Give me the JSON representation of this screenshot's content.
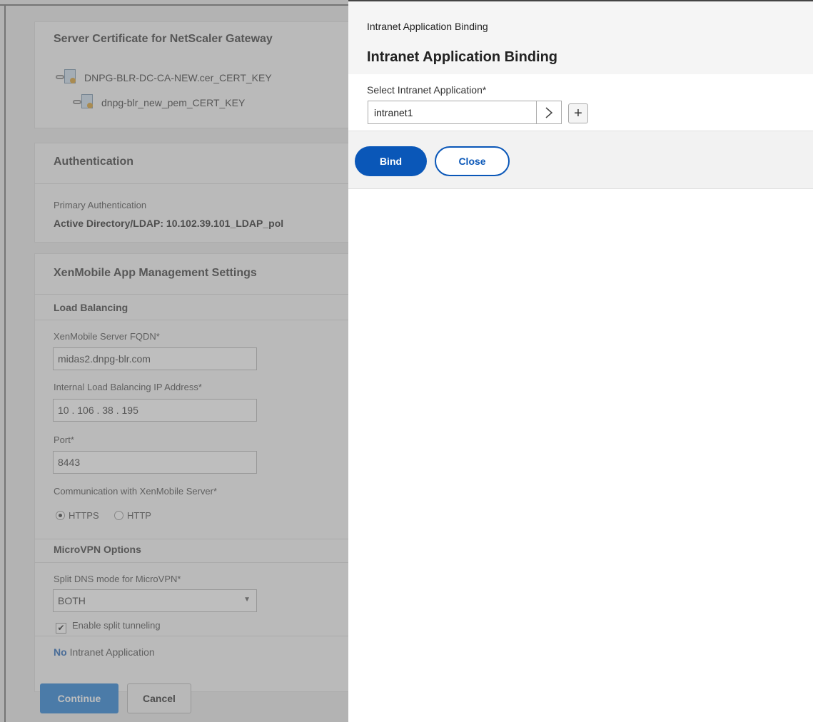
{
  "background": {
    "certificate": {
      "heading": "Server Certificate for NetScaler Gateway",
      "items": [
        "DNPG-BLR-DC-CA-NEW.cer_CERT_KEY",
        "dnpg-blr_new_pem_CERT_KEY"
      ]
    },
    "authentication": {
      "heading": "Authentication",
      "primary_label": "Primary Authentication",
      "primary_value": "Active Directory/LDAP: 10.102.39.101_LDAP_pol"
    },
    "xenmobile": {
      "heading": "XenMobile App Management Settings",
      "load_balancing": "Load Balancing",
      "fqdn_label": "XenMobile Server FQDN*",
      "fqdn_value": "midas2.dnpg-blr.com",
      "ip_label": "Internal Load Balancing IP Address*",
      "ip_value": "10 . 106 . 38 . 195",
      "port_label": "Port*",
      "port_value": "8443",
      "comm_label": "Communication with XenMobile Server*",
      "opt_https": "HTTPS",
      "opt_http": "HTTP",
      "microvpn": "MicroVPN Options",
      "split_dns_label": "Split DNS mode for MicroVPN*",
      "split_dns_value": "BOTH",
      "split_tunnel_label": "Enable split tunneling",
      "intranet_no": "No",
      "intranet_text": "Intranet Application"
    },
    "buttons": {
      "continue": "Continue",
      "cancel": "Cancel"
    }
  },
  "panel": {
    "breadcrumb": "Intranet Application Binding",
    "title": "Intranet Application Binding",
    "field_label": "Select Intranet Application*",
    "field_value": "intranet1",
    "arrow_glyph": ">",
    "add_glyph": "+",
    "bind_label": "Bind",
    "close_label": "Close"
  },
  "colors": {
    "primary": "#0a57b8",
    "dim_button": "#2e86d8"
  }
}
